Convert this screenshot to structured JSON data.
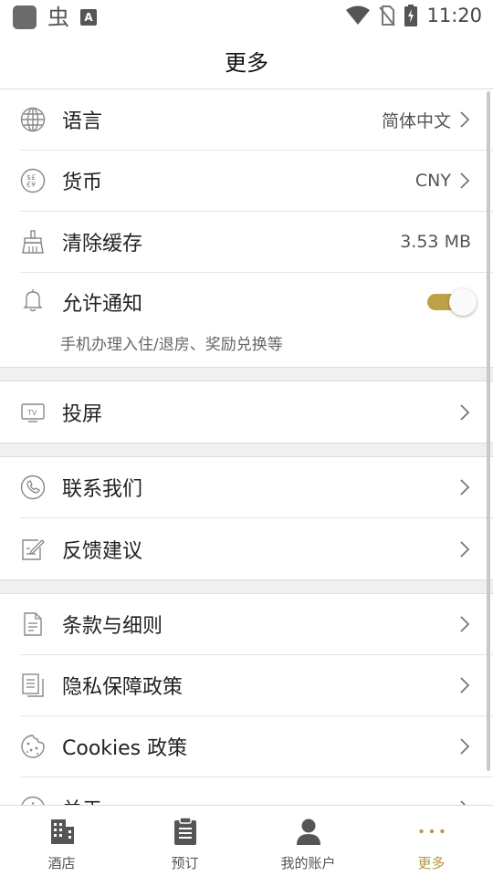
{
  "status_bar": {
    "time": "11:20",
    "app_glyph": "虫",
    "a_badge": "A"
  },
  "header": {
    "title": "更多"
  },
  "settings": {
    "language": {
      "label": "语言",
      "value": "简体中文"
    },
    "currency": {
      "label": "货币",
      "value": "CNY"
    },
    "clear_cache": {
      "label": "清除缓存",
      "value": "3.53 MB"
    },
    "notifications": {
      "label": "允许通知",
      "subtitle": "手机办理入住/退房、奖励兑换等",
      "enabled": true
    }
  },
  "cast": {
    "label": "投屏"
  },
  "contact": {
    "label": "联系我们"
  },
  "feedback": {
    "label": "反馈建议"
  },
  "terms": {
    "label": "条款与细则"
  },
  "privacy": {
    "label": "隐私保障政策"
  },
  "cookies": {
    "label": "Cookies 政策"
  },
  "about": {
    "label": "关于"
  },
  "tabs": [
    {
      "label": "酒店",
      "icon": "building-icon"
    },
    {
      "label": "预订",
      "icon": "clipboard-icon"
    },
    {
      "label": "我的账户",
      "icon": "person-icon"
    },
    {
      "label": "更多",
      "icon": "more-dots-icon",
      "active": true
    }
  ],
  "colors": {
    "accent": "#b8963e",
    "toggle_track": "#bfa04a",
    "icon_gray": "#888888"
  }
}
